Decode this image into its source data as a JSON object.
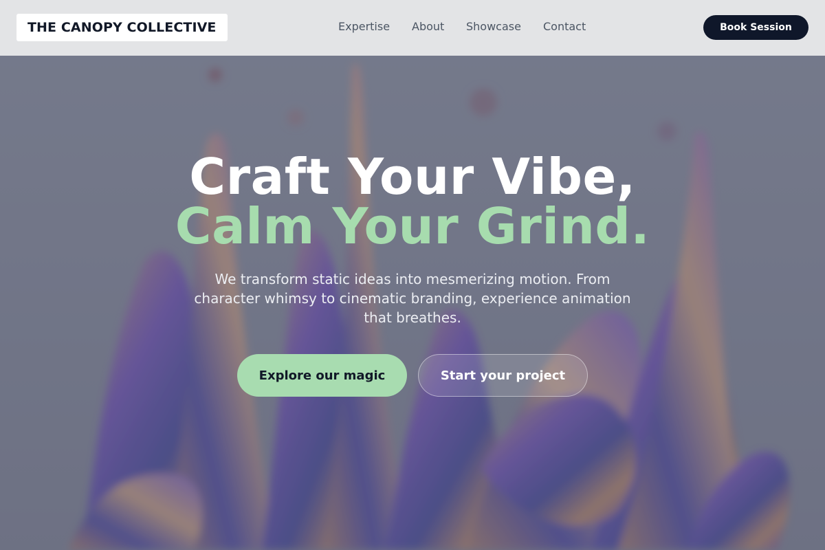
{
  "brand": {
    "name": "THE CANOPY COLLECTIVE"
  },
  "nav": {
    "links": [
      "Expertise",
      "About",
      "Showcase",
      "Contact"
    ],
    "cta_label": "Book Session"
  },
  "hero": {
    "headline_line1": "Craft Your Vibe,",
    "headline_line2": "Calm Your Grind.",
    "subtitle": "We transform static ideas into mesmerizing motion. From character whimsy to cinematic branding, experience animation that breathes.",
    "primary_cta": "Explore our magic",
    "secondary_cta": "Start your project",
    "background_image": "iridescent-liquid-splash-image"
  },
  "colors": {
    "header_bg": "#e3e4e6",
    "dark": "#0f172a",
    "accent_green": "#a7dcae",
    "overlay": "#606474"
  }
}
